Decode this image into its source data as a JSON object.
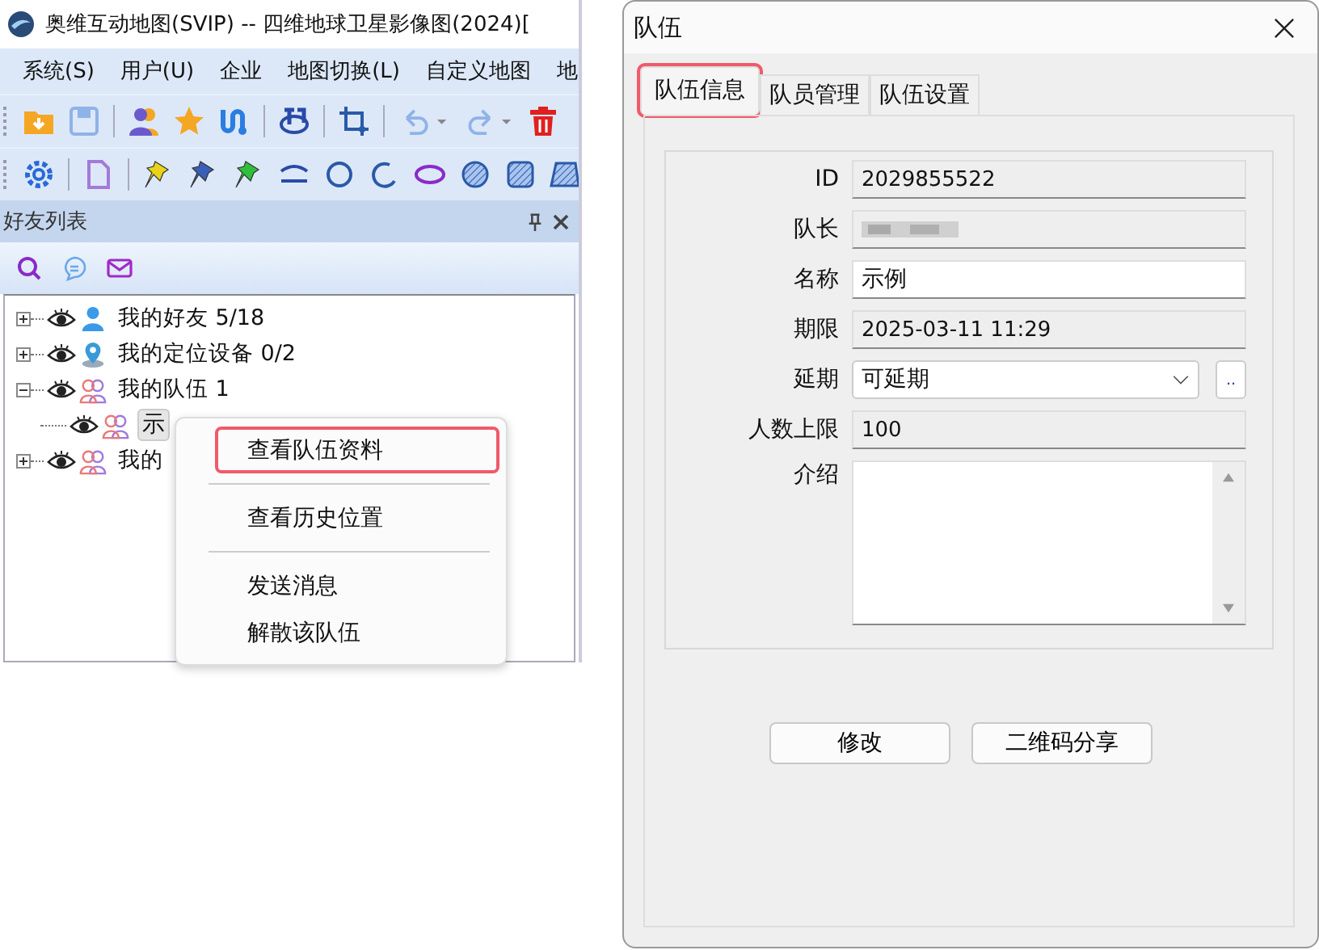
{
  "app": {
    "title": "奥维互动地图(SVIP) -- 四维地球卫星影像图(2024)[",
    "menu": [
      "系统(S)",
      "用户(U)",
      "企业",
      "地图切换(L)",
      "自定义地图",
      "地"
    ],
    "panel": {
      "title": "好友列表",
      "tree": [
        {
          "label": "我的好友 5/18",
          "kind": "person",
          "expanded": false,
          "selected": false
        },
        {
          "label": "我的定位设备 0/2",
          "kind": "device",
          "expanded": false,
          "selected": false
        },
        {
          "label": "我的队伍 1",
          "kind": "team",
          "expanded": true,
          "selected": false,
          "children": [
            {
              "label": "示",
              "kind": "team",
              "selected": true
            }
          ]
        },
        {
          "label": "我的",
          "kind": "team",
          "expanded": false,
          "selected": false
        }
      ]
    },
    "context_menu": [
      {
        "kind": "item",
        "label": "查看队伍资料",
        "highlighted": true
      },
      {
        "kind": "separator"
      },
      {
        "kind": "item",
        "label": "查看历史位置",
        "highlighted": false
      },
      {
        "kind": "separator"
      },
      {
        "kind": "item",
        "label": "发送消息",
        "highlighted": false
      },
      {
        "kind": "item",
        "label": "解散该队伍",
        "highlighted": false
      }
    ]
  },
  "dialog": {
    "title": "队伍",
    "tabs": [
      {
        "label": "队伍信息",
        "selected": true,
        "highlighted": true
      },
      {
        "label": "队员管理",
        "selected": false,
        "highlighted": false
      },
      {
        "label": "队伍设置",
        "selected": false,
        "highlighted": false
      }
    ],
    "fields": [
      {
        "label": "ID",
        "kind": "readonly",
        "value": "2029855522"
      },
      {
        "label": "队长",
        "kind": "masked"
      },
      {
        "label": "名称",
        "kind": "input",
        "value": "示例"
      },
      {
        "label": "期限",
        "kind": "readonly",
        "value": "2025-03-11 11:29"
      },
      {
        "label": "延期",
        "kind": "select",
        "value": "可延期",
        "button": ".."
      },
      {
        "label": "人数上限",
        "kind": "readonly",
        "value": "100"
      },
      {
        "label": "介绍",
        "kind": "textarea"
      }
    ],
    "buttons": [
      "修改",
      "二维码分享"
    ]
  }
}
